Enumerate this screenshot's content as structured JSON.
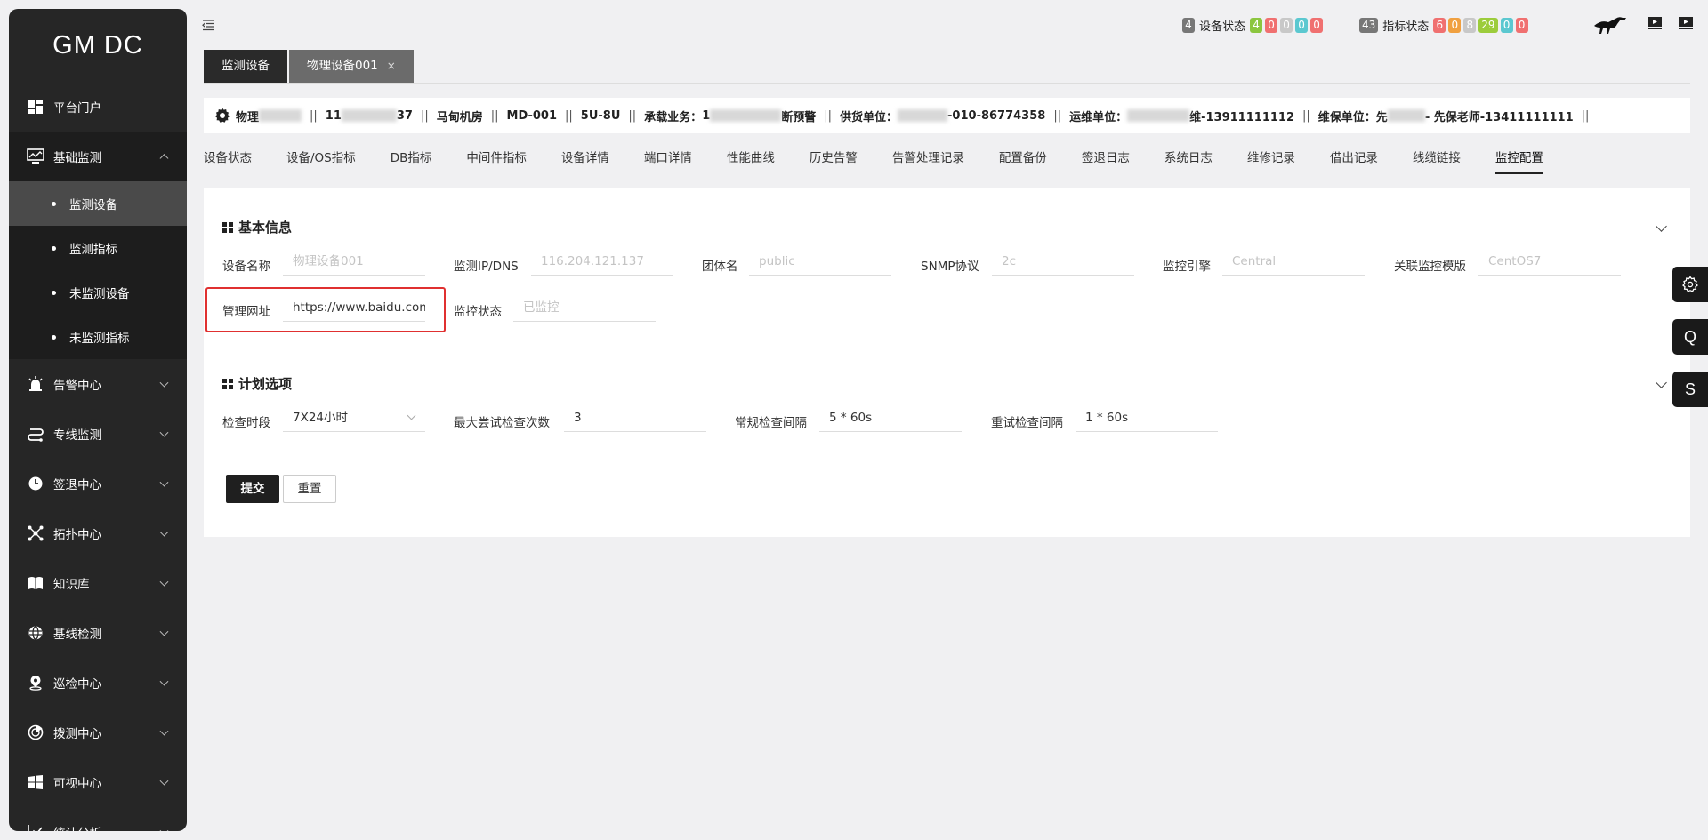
{
  "app": {
    "logo": "GM DC"
  },
  "sidebar": {
    "items": [
      {
        "label": "平台门户"
      },
      {
        "label": "基础监测",
        "children": [
          {
            "label": "监测设备",
            "active": true
          },
          {
            "label": "监测指标"
          },
          {
            "label": "未监测设备"
          },
          {
            "label": "未监测指标"
          }
        ]
      },
      {
        "label": "告警中心"
      },
      {
        "label": "专线监测"
      },
      {
        "label": "签退中心"
      },
      {
        "label": "拓扑中心"
      },
      {
        "label": "知识库"
      },
      {
        "label": "基线检测"
      },
      {
        "label": "巡检中心"
      },
      {
        "label": "拨测中心"
      },
      {
        "label": "可视中心"
      },
      {
        "label": "统计分析"
      }
    ]
  },
  "topbar": {
    "device_status": {
      "label": "设备状态",
      "total": "4",
      "counts": [
        "4",
        "0",
        "0",
        "0",
        "0"
      ]
    },
    "metric_status": {
      "label": "指标状态",
      "total": "43",
      "counts": [
        "6",
        "0",
        "8",
        "29",
        "0",
        "0"
      ]
    },
    "colors": {
      "green": "#8cc63f",
      "red": "#f07070",
      "grey": "#c8c8c8",
      "cyan": "#5bc8d0",
      "orange": "#f0a040",
      "dark": "#777777",
      "lime": "#9ccc3c"
    }
  },
  "tabs": [
    {
      "label": "监测设备",
      "active": true
    },
    {
      "label": "物理设备001",
      "closable": true,
      "close": "×"
    }
  ],
  "infobar": {
    "f1": "物理",
    "f2a": "11",
    "f2b": "37",
    "room": "马甸机房",
    "md": "MD-001",
    "u": "5U-8U",
    "biz_label": "承载业务：",
    "biz_a": "1",
    "biz_b": "断预警",
    "supplier_label": "供货单位：",
    "supplier_val": "-010-86774358",
    "ops_label": "运维单位：",
    "ops_val": "维-13911111112",
    "maint_label": "维保单位：",
    "maint_a": "先",
    "maint_b": "- 先保老师-13411111111",
    "sep": "||"
  },
  "subnav": [
    "设备状态",
    "设备/OS指标",
    "DB指标",
    "中间件指标",
    "设备详情",
    "端口详情",
    "性能曲线",
    "历史告警",
    "告警处理记录",
    "配置备份",
    "签退日志",
    "系统日志",
    "维修记录",
    "借出记录",
    "线缆链接",
    "监控配置"
  ],
  "basic": {
    "title": "基本信息",
    "device_name_label": "设备名称",
    "device_name_ph": "物理设备001",
    "ip_label": "监测IP/DNS",
    "ip_ph": "116.204.121.137",
    "community_label": "团体名",
    "community_ph": "public",
    "snmp_label": "SNMP协议",
    "snmp_ph": "2c",
    "engine_label": "监控引擎",
    "engine_ph": "Central",
    "template_label": "关联监控模版",
    "template_ph": "CentOS7",
    "url_label": "管理网址",
    "url_val": "https://www.baidu.com",
    "monitor_label": "监控状态",
    "monitor_ph": "已监控"
  },
  "plan": {
    "title": "计划选项",
    "period_label": "检查时段",
    "period_val": "7X24小时",
    "max_label": "最大尝试检查次数",
    "max_val": "3",
    "normal_label": "常规检查间隔",
    "normal_val": "5 * 60s",
    "retry_label": "重试检查间隔",
    "retry_val": "1 * 60s"
  },
  "buttons": {
    "submit": "提交",
    "reset": "重置"
  },
  "floating": {
    "q": "Q",
    "s": "S"
  }
}
